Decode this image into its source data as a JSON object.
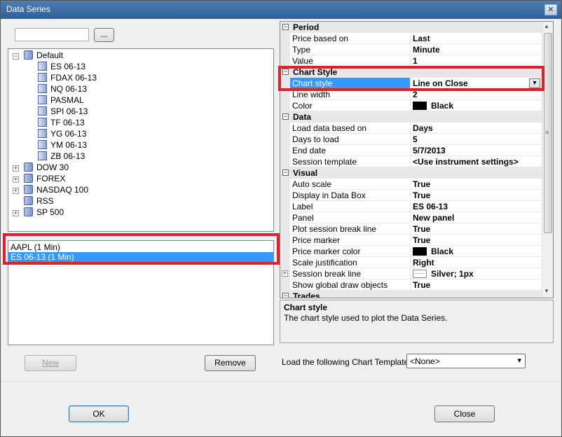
{
  "window": {
    "title": "Data Series",
    "close_glyph": "✕"
  },
  "search": {
    "value": "",
    "browse_label": "..."
  },
  "tree": {
    "items": [
      {
        "label": "Default",
        "level": 0,
        "expander": "−"
      },
      {
        "label": "ES 06-13",
        "level": 1
      },
      {
        "label": "FDAX 06-13",
        "level": 1
      },
      {
        "label": "NQ 06-13",
        "level": 1
      },
      {
        "label": "PASMAL",
        "level": 1
      },
      {
        "label": "SPI 06-13",
        "level": 1
      },
      {
        "label": "TF 06-13",
        "level": 1
      },
      {
        "label": "YG 06-13",
        "level": 1
      },
      {
        "label": "YM 06-13",
        "level": 1
      },
      {
        "label": "ZB 06-13",
        "level": 1
      },
      {
        "label": "DOW 30",
        "level": 0,
        "expander": "+"
      },
      {
        "label": "FOREX",
        "level": 0,
        "expander": "+"
      },
      {
        "label": "NASDAQ 100",
        "level": 0,
        "expander": "+"
      },
      {
        "label": "RSS",
        "level": 0
      },
      {
        "label": "SP 500",
        "level": 0,
        "expander": "+"
      }
    ]
  },
  "series_list": {
    "items": [
      "AAPL (1 Min)",
      "ES 06-13 (1 Min)"
    ],
    "selected_index": 1
  },
  "buttons": {
    "new": "New",
    "remove": "Remove",
    "ok": "OK",
    "close": "Close"
  },
  "properties": {
    "rows": [
      {
        "type": "category",
        "label": "Period",
        "expander": "−"
      },
      {
        "type": "prop",
        "name": "Price based on",
        "value": "Last"
      },
      {
        "type": "prop",
        "name": "Type",
        "value": "Minute"
      },
      {
        "type": "prop",
        "name": "Value",
        "value": "1"
      },
      {
        "type": "category",
        "label": "Chart Style",
        "expander": "−"
      },
      {
        "type": "prop",
        "name": "Chart style",
        "value": "Line on Close",
        "selected": true,
        "dropdown": "▾"
      },
      {
        "type": "prop",
        "name": "Line width",
        "value": "2"
      },
      {
        "type": "prop",
        "name": "Color",
        "value": "Black",
        "swatch": "#000000"
      },
      {
        "type": "category",
        "label": "Data",
        "expander": "−"
      },
      {
        "type": "prop",
        "name": "Load data based on",
        "value": "Days"
      },
      {
        "type": "prop",
        "name": "Days to load",
        "value": "5"
      },
      {
        "type": "prop",
        "name": "End date",
        "value": "5/7/2013"
      },
      {
        "type": "prop",
        "name": "Session template",
        "value": "<Use instrument settings>"
      },
      {
        "type": "category",
        "label": "Visual",
        "expander": "−"
      },
      {
        "type": "prop",
        "name": "Auto scale",
        "value": "True"
      },
      {
        "type": "prop",
        "name": "Display in Data Box",
        "value": "True"
      },
      {
        "type": "prop",
        "name": "Label",
        "value": "ES 06-13"
      },
      {
        "type": "prop",
        "name": "Panel",
        "value": "New panel"
      },
      {
        "type": "prop",
        "name": "Plot session break line",
        "value": "True"
      },
      {
        "type": "prop",
        "name": "Price marker",
        "value": "True"
      },
      {
        "type": "prop",
        "name": "Price marker color",
        "value": "Black",
        "swatch": "#000000"
      },
      {
        "type": "prop",
        "name": "Scale justification",
        "value": "Right"
      },
      {
        "type": "prop",
        "name": "Session break line",
        "value": "Silver; 1px",
        "line_swatch": true,
        "expander": "+"
      },
      {
        "type": "prop",
        "name": "Show global draw objects",
        "value": "True"
      },
      {
        "type": "category",
        "label": "Trades",
        "expander": "−"
      }
    ]
  },
  "description": {
    "title": "Chart style",
    "text": "The chart style used to plot the Data Series."
  },
  "template": {
    "label": "Load the following Chart Template:",
    "value": "<None>",
    "dropdown": "▾"
  },
  "scroll": {
    "up": "▲",
    "down": "▼",
    "grip": "≡"
  },
  "colors": {
    "highlight": "#3399ff",
    "red_box": "#e0202a",
    "category_bg": "#e8e8e8"
  }
}
